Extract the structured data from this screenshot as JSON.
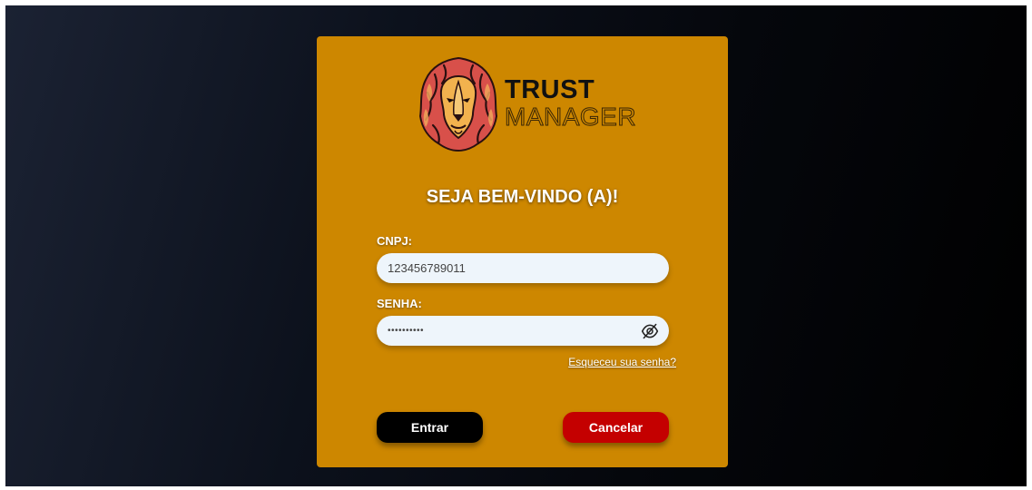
{
  "brand": {
    "line1": "TRUST",
    "line2": "MANAGER"
  },
  "welcome": "SEJA BEM-VINDO (A)!",
  "cnpj": {
    "label": "CNPJ:",
    "value": "123456789011"
  },
  "password": {
    "label": "SENHA:",
    "masked": "••••••••••",
    "icon": "eye-off-icon"
  },
  "forgot_link": "Esqueceu sua senha?",
  "buttons": {
    "enter": "Entrar",
    "cancel": "Cancelar"
  },
  "colors": {
    "card": "#cd8700",
    "enter_button": "#000000",
    "cancel_button": "#c40000",
    "field_bg": "#eef5fb"
  }
}
